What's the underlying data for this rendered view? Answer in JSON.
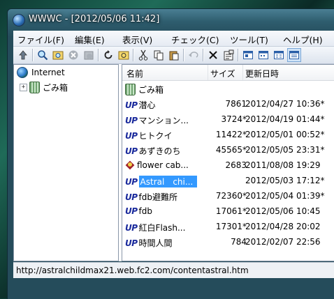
{
  "window": {
    "title": "WWWC - [2012/05/06 11:42]"
  },
  "menu": [
    "ファイル(F)",
    "編集(E)",
    "表示(V)",
    "チェック(C)",
    "ツール(T)",
    "ヘルプ(H)"
  ],
  "toolbar_icons": [
    "up-folder-icon",
    "check-icon",
    "check-all-icon",
    "stop-icon",
    "stop-all-icon",
    "refresh-icon",
    "open-folder-icon",
    "cut-icon",
    "copy-icon",
    "paste-icon",
    "undo-icon",
    "delete-icon",
    "properties-icon",
    "view-large-icon",
    "view-small-icon",
    "view-list-icon",
    "view-details-icon"
  ],
  "tree": {
    "root_label": "Internet",
    "child_label": "ごみ箱",
    "expander": "+"
  },
  "list": {
    "columns": {
      "name": "名前",
      "size": "サイズ",
      "date": "更新日時"
    },
    "up_badge": "UP",
    "rows": [
      {
        "icon": "trash",
        "name": "ごみ箱",
        "size": "",
        "date": ""
      },
      {
        "icon": "up",
        "name": "潜心",
        "size": "7861",
        "date": "2012/04/27 10:36*"
      },
      {
        "icon": "up",
        "name": "マンション...",
        "size": "3724*",
        "date": "2012/04/19 01:44*"
      },
      {
        "icon": "up",
        "name": "ヒトクイ",
        "size": "11422*",
        "date": "2012/05/01 00:52*"
      },
      {
        "icon": "up",
        "name": "あずきのち",
        "size": "45565*",
        "date": "2012/05/05 23:31*"
      },
      {
        "icon": "flower",
        "name": "flower cab...",
        "size": "2683",
        "date": "2011/08/08 19:29"
      },
      {
        "icon": "up",
        "name": "Astral　chi...",
        "size": "",
        "date": "2012/05/03 17:12*",
        "selected": true
      },
      {
        "icon": "up",
        "name": "fdb避難所",
        "size": "72360*",
        "date": "2012/05/04 01:39*"
      },
      {
        "icon": "up",
        "name": "fdb",
        "size": "17061*",
        "date": "2012/05/06 10:45"
      },
      {
        "icon": "up",
        "name": "紅白Flash...",
        "size": "17301*",
        "date": "2012/04/28 20:02"
      },
      {
        "icon": "up",
        "name": "時間人間",
        "size": "784",
        "date": "2012/02/07 22:56"
      }
    ]
  },
  "status": {
    "text": "http://astralchildmax21.web.fc2.com/contentastral.htm"
  }
}
